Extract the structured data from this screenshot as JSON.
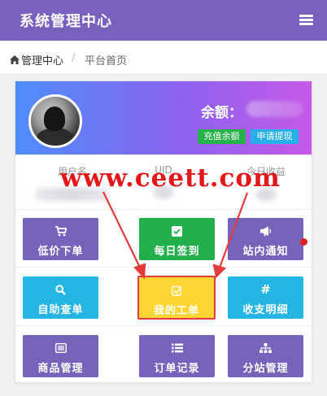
{
  "header": {
    "title": "系统管理中心",
    "menu_icon": "hamburger-menu-icon"
  },
  "breadcrumb": {
    "home_icon": "home-icon",
    "home": "管理中心",
    "separator": "/",
    "current": "平台首页"
  },
  "profile": {
    "balance_label": "余额：",
    "recharge_button": "充值余额",
    "withdraw_button": "申请提现"
  },
  "stats": {
    "items": [
      {
        "label": "用户名"
      },
      {
        "label": "UID"
      },
      {
        "label": "今日收益"
      }
    ]
  },
  "watermark": "www.ceett.com",
  "menu": {
    "rows": [
      [
        {
          "label": "低价下单",
          "icon": "cart-icon",
          "color": "#7663bc"
        },
        {
          "label": "每日签到",
          "icon": "checkbox-icon",
          "color": "#23b04c"
        },
        {
          "label": "站内通知",
          "icon": "megaphone-icon",
          "color": "#7663bc",
          "notification_dot": true
        }
      ],
      [
        {
          "label": "自助查单",
          "icon": "search-icon",
          "color": "#24b5e3"
        },
        {
          "label": "我的工单",
          "icon": "edit-check-icon",
          "color": "#fed532",
          "highlighted": true
        },
        {
          "label": "收支明细",
          "icon": "hash-icon",
          "color": "#24b5e3"
        }
      ],
      [
        {
          "label": "商品管理",
          "icon": "list-box-icon",
          "color": "#7663bc"
        },
        {
          "label": "订单记录",
          "icon": "list-icon",
          "color": "#7663bc"
        },
        {
          "label": "分站管理",
          "icon": "sitemap-icon",
          "color": "#7663bc"
        }
      ]
    ]
  },
  "colors": {
    "accent": "#7761bd",
    "annotation": "#e33b3b"
  }
}
